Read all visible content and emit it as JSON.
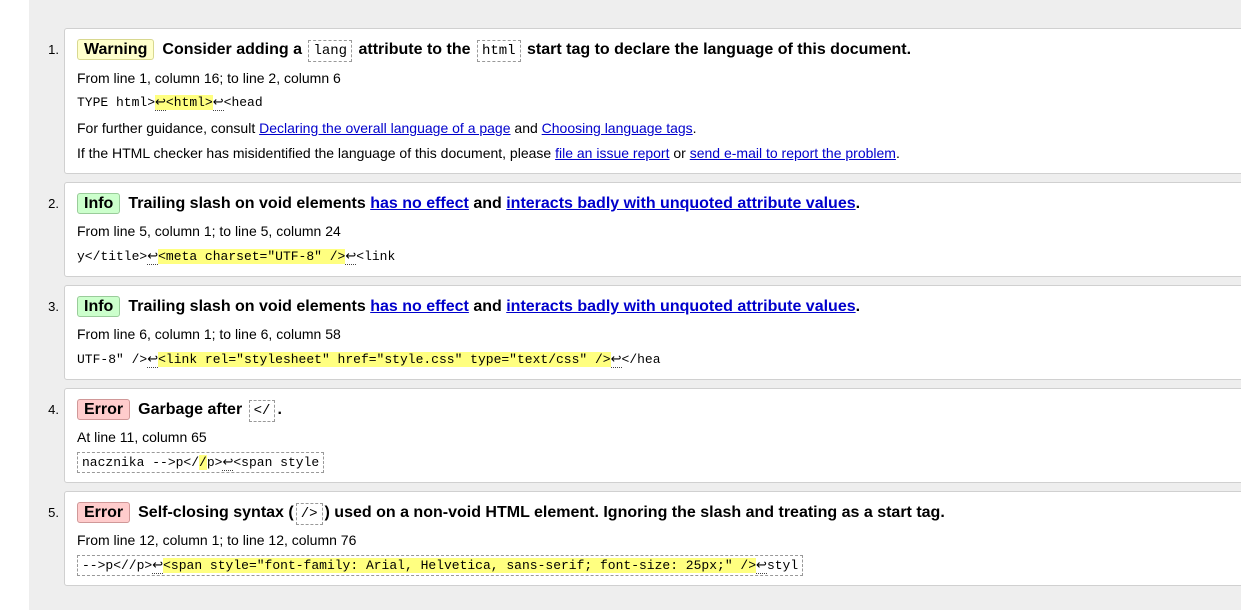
{
  "messages": [
    {
      "num": "1.",
      "badge": "Warning",
      "title_a": "Consider adding a",
      "code_a": "lang",
      "title_b": "attribute to the",
      "code_b": "html",
      "title_c": "start tag to declare the language of this document.",
      "location": "From line 1, column 16; to line 2, column 6",
      "extract_pre": "TYPE html>",
      "extract_lf1": "↩",
      "extract_hl": "<html>",
      "extract_lf2": "↩",
      "extract_post": "<head",
      "guidance_pre": "For further guidance, consult",
      "link_1": "Declaring the overall language of a page",
      "guidance_mid": "and",
      "link_2": "Choosing language tags",
      "guidance_post": ".",
      "report_pre": "If the HTML checker has misidentified the language of this document, please",
      "link_3": "file an issue report",
      "report_mid": "or",
      "link_4": "send e-mail to report the problem",
      "report_post": "."
    },
    {
      "num": "2.",
      "badge": "Info",
      "title_a": "Trailing slash on void elements",
      "link_1": "has no effect",
      "title_b": "and",
      "link_2": "interacts badly with unquoted attribute values",
      "title_c": ".",
      "location": "From line 5, column 1; to line 5, column 24",
      "extract_pre": "y</title>",
      "extract_lf1": "↩",
      "extract_hl": "<meta charset=\"UTF-8\" />",
      "extract_lf2": "↩",
      "extract_post": "<link"
    },
    {
      "num": "3.",
      "badge": "Info",
      "title_a": "Trailing slash on void elements",
      "link_1": "has no effect",
      "title_b": "and",
      "link_2": "interacts badly with unquoted attribute values",
      "title_c": ".",
      "location": "From line 6, column 1; to line 6, column 58",
      "extract_pre": "UTF-8\" />",
      "extract_lf1": "↩",
      "extract_hl": "<link rel=\"stylesheet\" href=\"style.css\" type=\"text/css\" />",
      "extract_lf2": "↩",
      "extract_post": "</hea"
    },
    {
      "num": "4.",
      "badge": "Error",
      "title_a": "Garbage after",
      "code_a": "</",
      "title_c": ".",
      "location": "At line 11, column 65",
      "extract_pre": "nacznika -->p</",
      "extract_hl": "/",
      "extract_mid": "p>",
      "extract_lf1": "↩",
      "extract_post": "<span style"
    },
    {
      "num": "5.",
      "badge": "Error",
      "title_a": "Self-closing syntax (",
      "code_a": "/>",
      "title_c": ") used on a non-void HTML element. Ignoring the slash and treating as a start tag.",
      "location": "From line 12, column 1; to line 12, column 76",
      "extract_pre": "-->p<//p>",
      "extract_lf1": "↩",
      "extract_hl": "<span style=\"font-family: Arial, Helvetica, sans-serif; font-size: 25px;\" />",
      "extract_lf2": "↩",
      "extract_post": "styl"
    }
  ],
  "colors": {
    "warning_badge": "#ffffcc",
    "info_badge": "#ccffcc",
    "error_badge": "#ffcccc",
    "link": "#0000cc",
    "highlight": "#ffff80"
  }
}
